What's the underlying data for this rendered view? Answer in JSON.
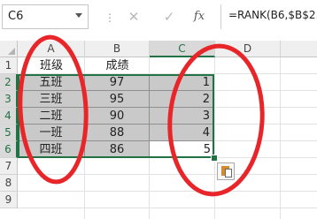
{
  "formula_bar": {
    "name_box": "C6",
    "cancel_icon": "close-icon",
    "enter_icon": "check-icon",
    "function_label": "fx",
    "formula": "=RANK(B6,$B$2:$"
  },
  "columns": [
    "A",
    "B",
    "C",
    "D"
  ],
  "rows": [
    "1",
    "2",
    "3",
    "4",
    "5",
    "6",
    "7",
    "8",
    "9"
  ],
  "sheet": {
    "headers": {
      "class": "班级",
      "score": "成绩"
    },
    "records": [
      {
        "class": "五班",
        "score": "97",
        "rank": "1"
      },
      {
        "class": "三班",
        "score": "95",
        "rank": "2"
      },
      {
        "class": "二班",
        "score": "90",
        "rank": "3"
      },
      {
        "class": "一班",
        "score": "88",
        "rank": "4"
      },
      {
        "class": "四班",
        "score": "86",
        "rank": "5"
      }
    ]
  },
  "colors": {
    "accent": "#217346",
    "annotation": "#e8262a",
    "selection_fill": "#c9c9c9"
  }
}
